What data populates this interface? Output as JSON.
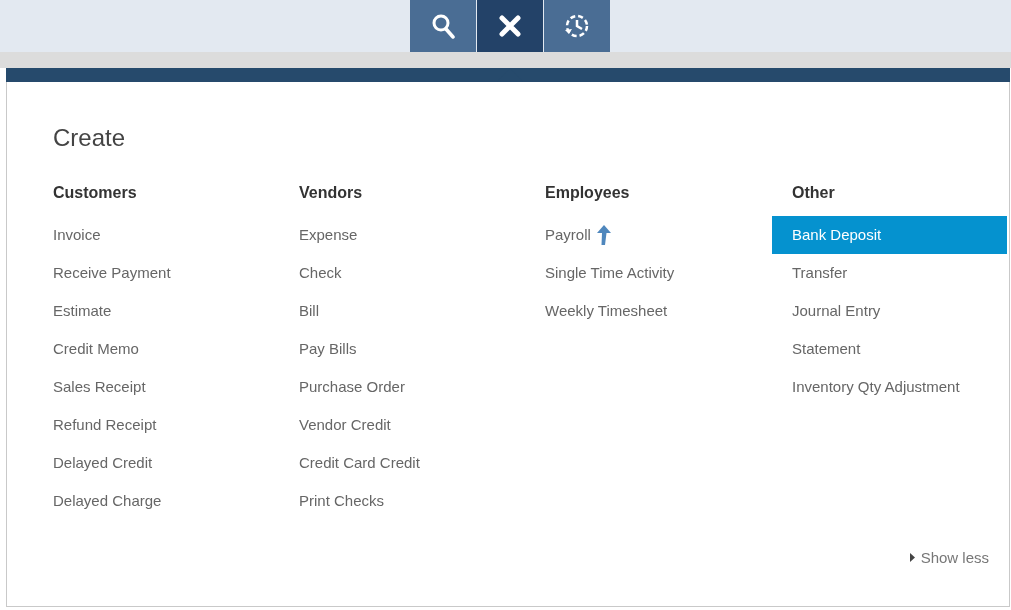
{
  "toolbar": [
    {
      "kind": "search",
      "selected": false
    },
    {
      "kind": "close",
      "selected": true
    },
    {
      "kind": "history",
      "selected": false
    }
  ],
  "panel": {
    "title": "Create",
    "columns": [
      {
        "heading": "Customers",
        "items": [
          {
            "label": "Invoice",
            "kind": "plain",
            "selected": false
          },
          {
            "label": "Receive Payment",
            "kind": "plain",
            "selected": false
          },
          {
            "label": "Estimate",
            "kind": "plain",
            "selected": false
          },
          {
            "label": "Credit Memo",
            "kind": "plain",
            "selected": false
          },
          {
            "label": "Sales Receipt",
            "kind": "plain",
            "selected": false
          },
          {
            "label": "Refund Receipt",
            "kind": "plain",
            "selected": false
          },
          {
            "label": "Delayed Credit",
            "kind": "plain",
            "selected": false
          },
          {
            "label": "Delayed Charge",
            "kind": "plain",
            "selected": false
          }
        ]
      },
      {
        "heading": "Vendors",
        "items": [
          {
            "label": "Expense",
            "kind": "plain",
            "selected": false
          },
          {
            "label": "Check",
            "kind": "plain",
            "selected": false
          },
          {
            "label": "Bill",
            "kind": "plain",
            "selected": false
          },
          {
            "label": "Pay Bills",
            "kind": "plain",
            "selected": false
          },
          {
            "label": "Purchase Order",
            "kind": "plain",
            "selected": false
          },
          {
            "label": "Vendor Credit",
            "kind": "plain",
            "selected": false
          },
          {
            "label": "Credit Card Credit",
            "kind": "plain",
            "selected": false
          },
          {
            "label": "Print Checks",
            "kind": "plain",
            "selected": false
          }
        ]
      },
      {
        "heading": "Employees",
        "items": [
          {
            "label": "Payroll",
            "kind": "upgrade",
            "selected": false
          },
          {
            "label": "Single Time Activity",
            "kind": "plain",
            "selected": false
          },
          {
            "label": "Weekly Timesheet",
            "kind": "plain",
            "selected": false
          }
        ]
      },
      {
        "heading": "Other",
        "items": [
          {
            "label": "Bank Deposit",
            "kind": "plain",
            "selected": true
          },
          {
            "label": "Transfer",
            "kind": "plain",
            "selected": false
          },
          {
            "label": "Journal Entry",
            "kind": "plain",
            "selected": false
          },
          {
            "label": "Statement",
            "kind": "plain",
            "selected": false
          },
          {
            "label": "Inventory Qty Adjustment",
            "kind": "plain",
            "selected": false
          }
        ]
      }
    ],
    "toggle": "Show less"
  }
}
